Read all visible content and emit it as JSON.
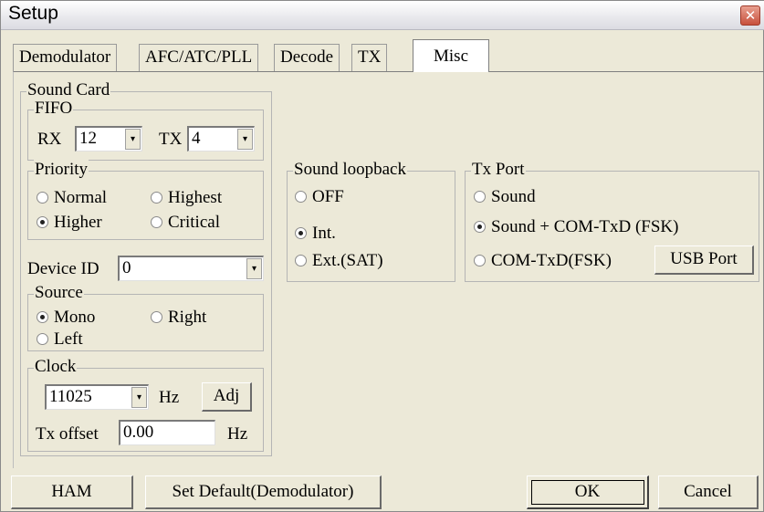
{
  "window": {
    "title": "Setup",
    "close_glyph": "✕"
  },
  "tabs": [
    "Demodulator",
    "AFC/ATC/PLL",
    "Decode",
    "TX",
    "Misc"
  ],
  "sound_card": {
    "legend": "Sound Card",
    "fifo": {
      "legend": "FIFO",
      "rx_label": "RX",
      "rx_value": "12",
      "tx_label": "TX",
      "tx_value": "4"
    },
    "priority": {
      "legend": "Priority",
      "normal": "Normal",
      "highest": "Highest",
      "higher": "Higher",
      "critical": "Critical",
      "selected": "Higher"
    },
    "device": {
      "label": "Device ID",
      "value": "0"
    },
    "source": {
      "legend": "Source",
      "mono": "Mono",
      "right": "Right",
      "left": "Left",
      "selected": "Mono"
    },
    "clock": {
      "legend": "Clock",
      "value": "11025",
      "unit": "Hz",
      "adj_label": "Adj",
      "offset_label": "Tx offset",
      "offset_value": "0.00",
      "offset_unit": "Hz"
    }
  },
  "loopback": {
    "legend": "Sound loopback",
    "off": "OFF",
    "int": "Int.",
    "ext": "Ext.(SAT)",
    "selected": "Int."
  },
  "tx_port": {
    "legend": "Tx Port",
    "sound": "Sound",
    "sound_com": "Sound + COM-TxD (FSK)",
    "com": "COM-TxD(FSK)",
    "usb_label": "USB Port",
    "selected": "Sound + COM-TxD (FSK)"
  },
  "footer": {
    "ham_label": "HAM",
    "default_label": "Set Default(Demodulator)",
    "ok_label": "OK",
    "cancel_label": "Cancel"
  },
  "icons": {
    "dropdown": "▾"
  }
}
